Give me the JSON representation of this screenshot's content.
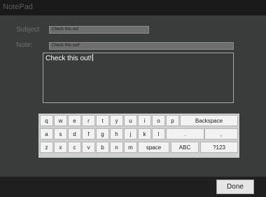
{
  "app": {
    "title": "NotePad"
  },
  "form": {
    "subject_label": "Subject",
    "subject_value": "Check this out",
    "note_label": "Note:",
    "note_value": "Check this out!",
    "note_text": "Check this out!"
  },
  "keyboard": {
    "row1": [
      "q",
      "w",
      "e",
      "r",
      "t",
      "y",
      "u",
      "i",
      "o",
      "p",
      "Backspace"
    ],
    "row2": [
      "a",
      "s",
      "d",
      "f",
      "g",
      "h",
      "j",
      "k",
      "l",
      ".",
      ","
    ],
    "row3": [
      "z",
      "x",
      "c",
      "v",
      "b",
      "n",
      "m",
      "space",
      "ABC",
      "?123"
    ]
  },
  "actions": {
    "done_label": "Done"
  }
}
